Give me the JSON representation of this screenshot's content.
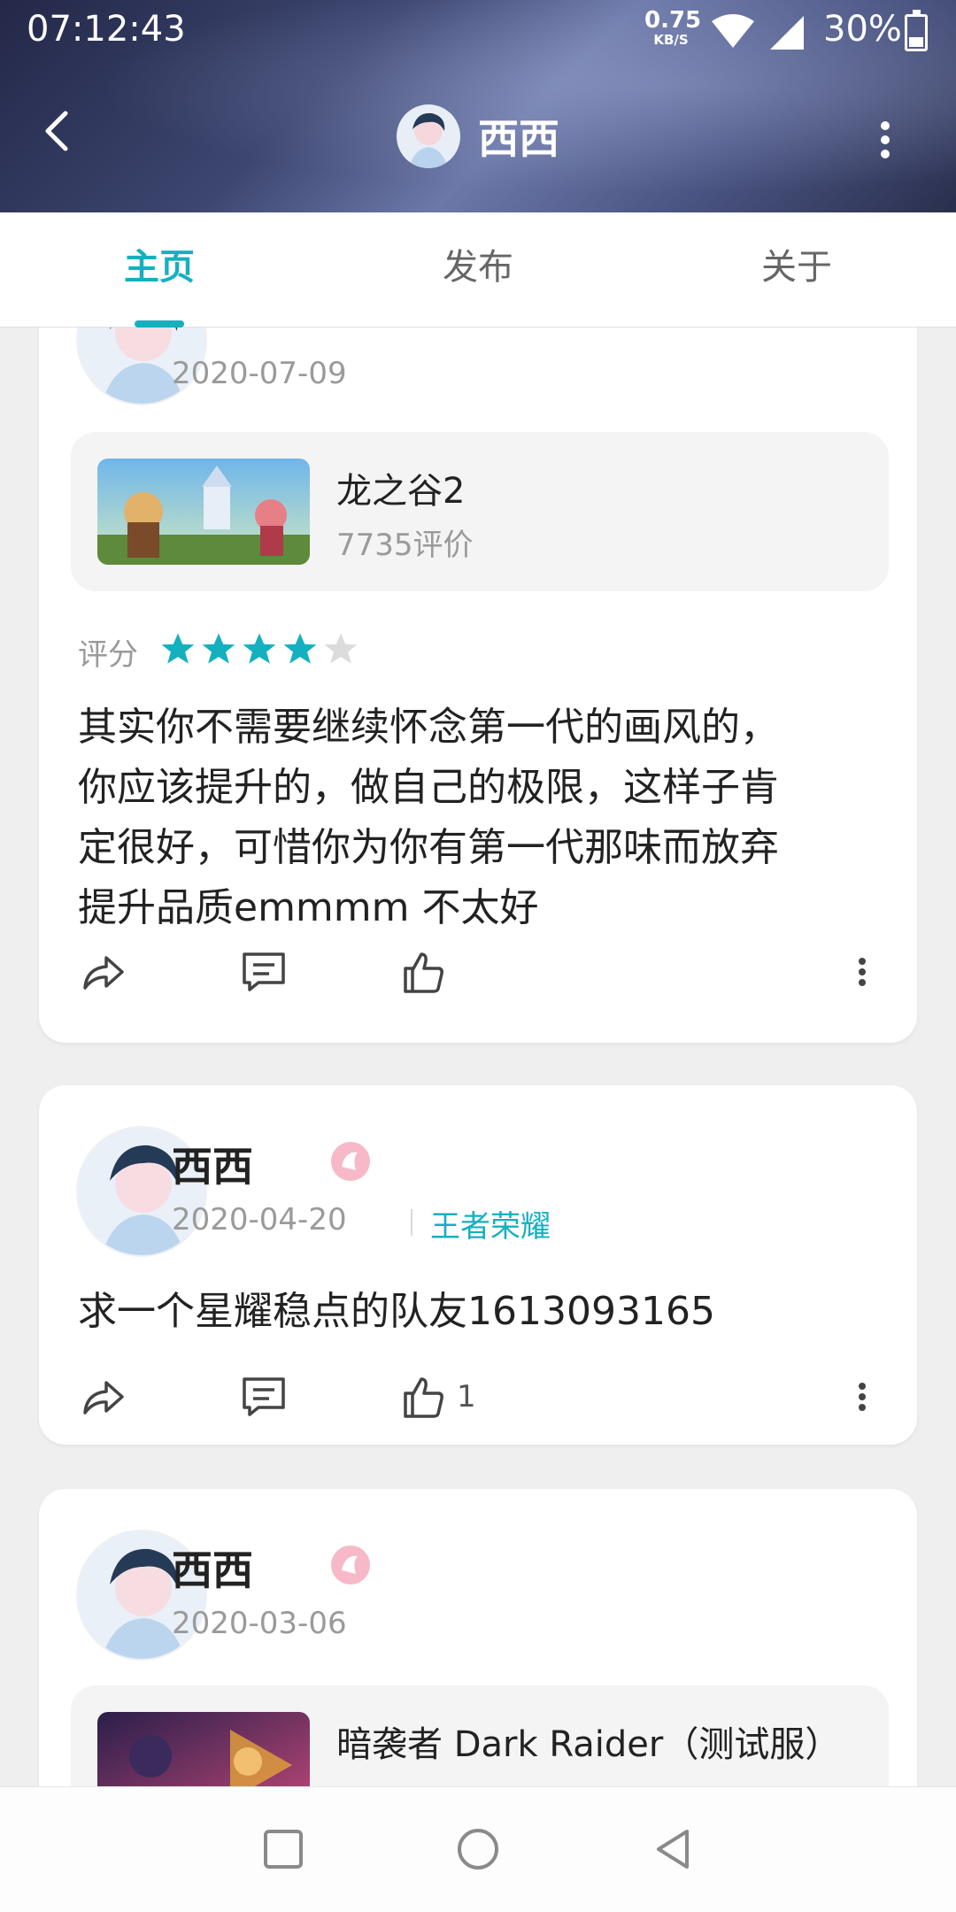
{
  "status_bar": {
    "time": "07:12:43",
    "net_speed": "0.75",
    "net_unit": "KB/S",
    "battery": "30%"
  },
  "header": {
    "title": "西西",
    "icons": [
      "back-arrow-icon",
      "avatar",
      "more-vertical-icon"
    ]
  },
  "tabs": [
    {
      "label": "主页",
      "active": true
    },
    {
      "label": "发布",
      "active": false
    },
    {
      "label": "关于",
      "active": false
    }
  ],
  "posts": [
    {
      "date": "2020-07-09",
      "game": {
        "title": "龙之谷2",
        "reviews": "7735评价"
      },
      "rating_label": "评分",
      "rating": 4,
      "rating_max": 5,
      "text_lines": [
        "其实你不需要继续怀念第一代的画风的，",
        "你应该提升的，做自己的极限，这样子肯",
        "定很好，可惜你为你有第一代那味而放弃",
        "提升品质emmmm 不太好"
      ]
    },
    {
      "author": "西西",
      "date": "2020-04-20",
      "tag": "王者荣耀",
      "text": "求一个星耀稳点的队友1613093165",
      "like_count": "1"
    },
    {
      "author": "西西",
      "date": "2020-03-06",
      "game": {
        "title": "暗袭者 Dark Raider（测试服）"
      }
    }
  ],
  "accent_color": "#15b0c0",
  "system_nav": [
    "square-icon",
    "circle-icon",
    "triangle-back-icon"
  ]
}
